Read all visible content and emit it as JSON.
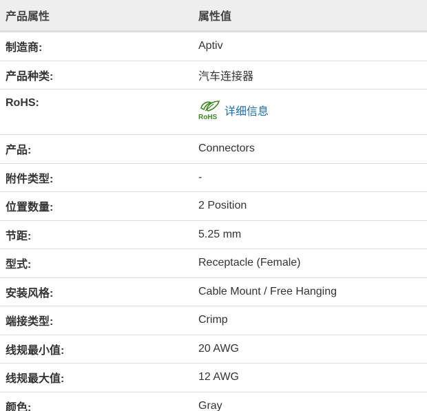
{
  "header": {
    "attribute_col": "产品属性",
    "value_col": "属性值"
  },
  "rows": [
    {
      "label": "制造商:",
      "value": "Aptiv"
    },
    {
      "label": "产品种类:",
      "value": "汽车连接器"
    },
    {
      "label": "RoHS:",
      "value": "详细信息",
      "logo_text": "RoHS"
    },
    {
      "label": "产品:",
      "value": "Connectors"
    },
    {
      "label": "附件类型:",
      "value": "-"
    },
    {
      "label": "位置数量:",
      "value": "2 Position"
    },
    {
      "label": "节距:",
      "value": "5.25 mm"
    },
    {
      "label": "型式:",
      "value": "Receptacle (Female)"
    },
    {
      "label": "安装风格:",
      "value": "Cable Mount / Free Hanging"
    },
    {
      "label": "端接类型:",
      "value": "Crimp"
    },
    {
      "label": "线规最小值:",
      "value": "20 AWG"
    },
    {
      "label": "线规最大值:",
      "value": "12 AWG"
    },
    {
      "label": "颜色:",
      "value": "Gray"
    }
  ],
  "colors": {
    "header_bg": "#eeeeee",
    "border": "#dddddd",
    "link": "#1a6fb5",
    "rohs_green": "#3a8a1e"
  }
}
